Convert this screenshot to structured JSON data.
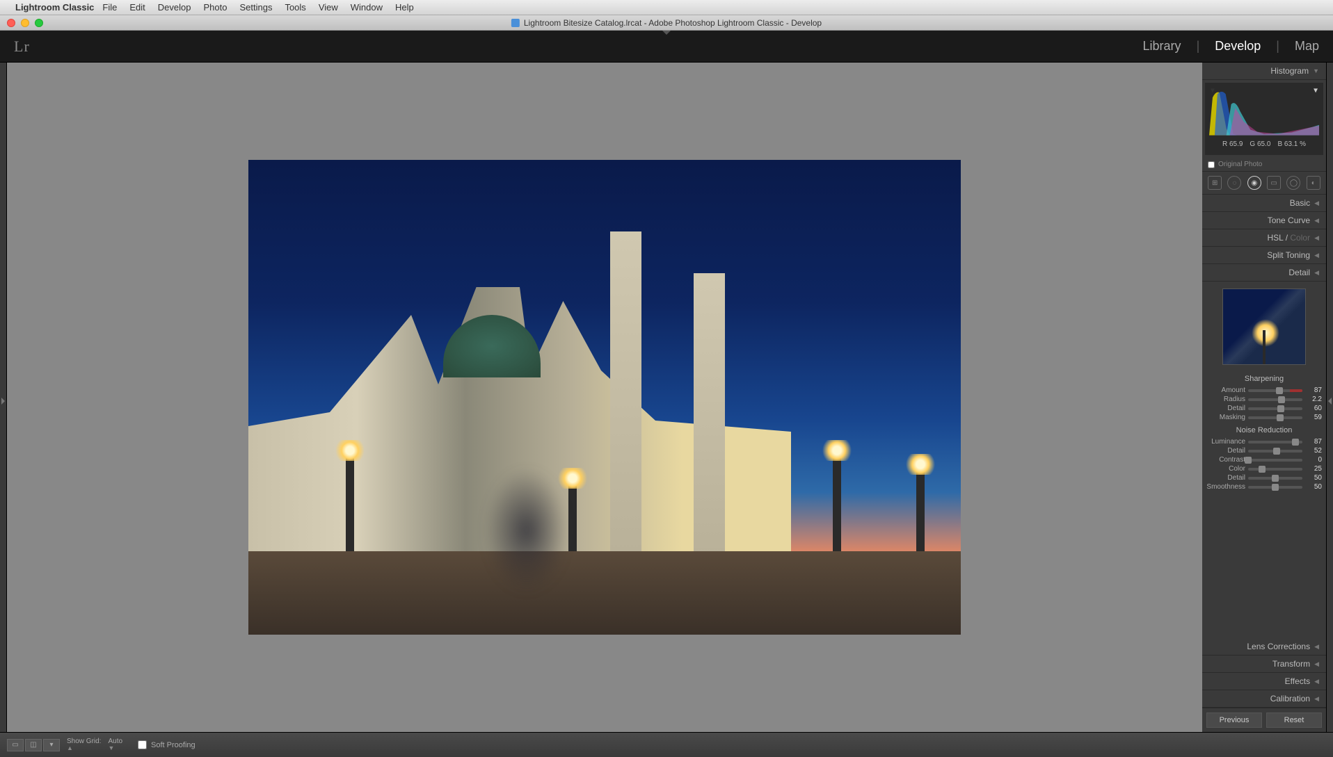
{
  "menubar": {
    "app_name": "Lightroom Classic",
    "items": [
      "File",
      "Edit",
      "Develop",
      "Photo",
      "Settings",
      "Tools",
      "View",
      "Window",
      "Help"
    ]
  },
  "titlebar": {
    "document": "Lightroom Bitesize Catalog.lrcat - Adobe Photoshop Lightroom Classic - Develop"
  },
  "logo": "Lr",
  "modules": {
    "library": "Library",
    "develop": "Develop",
    "map": "Map",
    "active": "Develop"
  },
  "right_panel": {
    "histogram_label": "Histogram",
    "readout": {
      "r_label": "R",
      "r": "65.9",
      "g_label": "G",
      "g": "65.0",
      "b_label": "B",
      "b": "63.1",
      "pct": "%"
    },
    "original_photo": "Original Photo",
    "sections": {
      "basic": "Basic",
      "tone_curve": "Tone Curve",
      "hsl": "HSL",
      "color": "Color",
      "split_toning": "Split Toning",
      "detail": "Detail",
      "lens": "Lens Corrections",
      "transform": "Transform",
      "effects": "Effects",
      "calibration": "Calibration"
    },
    "detail": {
      "sharpening_title": "Sharpening",
      "sharpening": {
        "amount": {
          "label": "Amount",
          "value": "87",
          "pos": 58
        },
        "radius": {
          "label": "Radius",
          "value": "2.2",
          "pos": 62
        },
        "detail_s": {
          "label": "Detail",
          "value": "60",
          "pos": 60
        },
        "masking": {
          "label": "Masking",
          "value": "59",
          "pos": 59
        }
      },
      "noise_title": "Noise Reduction",
      "noise": {
        "luminance": {
          "label": "Luminance",
          "value": "87",
          "pos": 87
        },
        "detail_n": {
          "label": "Detail",
          "value": "52",
          "pos": 52
        },
        "contrast": {
          "label": "Contrast",
          "value": "0",
          "pos": 0
        },
        "color": {
          "label": "Color",
          "value": "25",
          "pos": 25
        },
        "detail_c": {
          "label": "Detail",
          "value": "50",
          "pos": 50
        },
        "smoothness": {
          "label": "Smoothness",
          "value": "50",
          "pos": 50
        }
      }
    },
    "previous": "Previous",
    "reset": "Reset"
  },
  "toolbar": {
    "show_grid": "Show Grid:",
    "auto": "Auto",
    "soft_proofing": "Soft Proofing"
  }
}
